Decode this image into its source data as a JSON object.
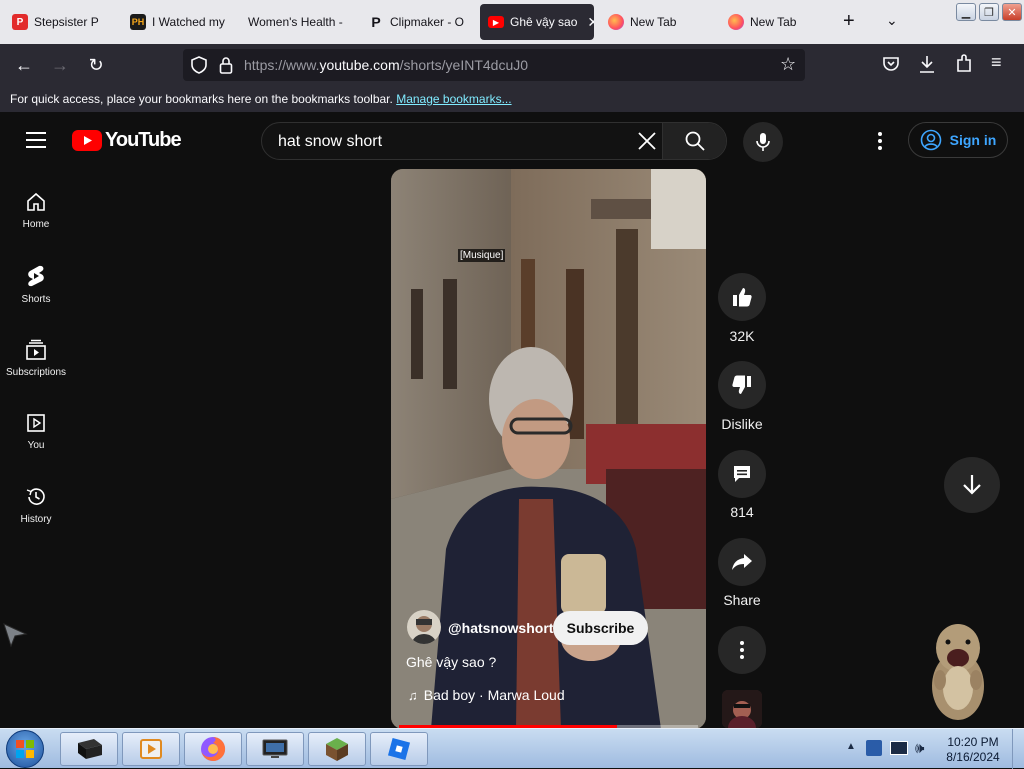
{
  "browser": {
    "tabs": [
      {
        "label": "Stepsister P",
        "favicon_color": "#e22b2b",
        "favicon_text": "P"
      },
      {
        "label": "I Watched my",
        "favicon_color": "#f7a81b",
        "favicon_text": "PH"
      },
      {
        "label": "Women's Health -",
        "favicon_color": "#e8e8ec",
        "favicon_text": ""
      },
      {
        "label": "Clipmaker - O",
        "favicon_color": "#e8e8ec",
        "favicon_text": "P"
      },
      {
        "label": "Ghê vậy sao",
        "favicon_color": "#ff0000",
        "favicon_text": "▶",
        "active": true
      },
      {
        "label": "New Tab",
        "favicon_color": "#ff7139",
        "favicon_text": ""
      },
      {
        "label": "New Tab",
        "favicon_color": "#ff7139",
        "favicon_text": ""
      }
    ],
    "url_prefix": "https://www.",
    "url_domain": "youtube.com",
    "url_path": "/shorts/yeINT4dcuJ0",
    "bookmarks_text": "For quick access, place your bookmarks here on the bookmarks toolbar.",
    "bookmarks_link": "Manage bookmarks..."
  },
  "youtube": {
    "logo_text": "YouTube",
    "search_value": "hat snow short",
    "signin_label": "Sign in",
    "sidebar": [
      {
        "label": "Home",
        "icon": "home-icon"
      },
      {
        "label": "Shorts",
        "icon": "shorts-icon"
      },
      {
        "label": "Subscriptions",
        "icon": "subscriptions-icon"
      },
      {
        "label": "You",
        "icon": "you-icon"
      },
      {
        "label": "History",
        "icon": "history-icon"
      }
    ],
    "video": {
      "caption": "[Musique]",
      "channel": "@hatsnowshort",
      "subscribe_label": "Subscribe",
      "title": "Ghê vậy sao ?",
      "music": "Bad boy · Marwa Loud"
    },
    "actions": {
      "likes": "32K",
      "dislike": "Dislike",
      "comments": "814",
      "share": "Share"
    }
  },
  "taskbar": {
    "time": "10:20 PM",
    "date": "8/16/2024"
  },
  "colors": {
    "yt_red": "#ff0000",
    "link_blue": "#3ea6ff",
    "bg": "#0f0f0f"
  }
}
